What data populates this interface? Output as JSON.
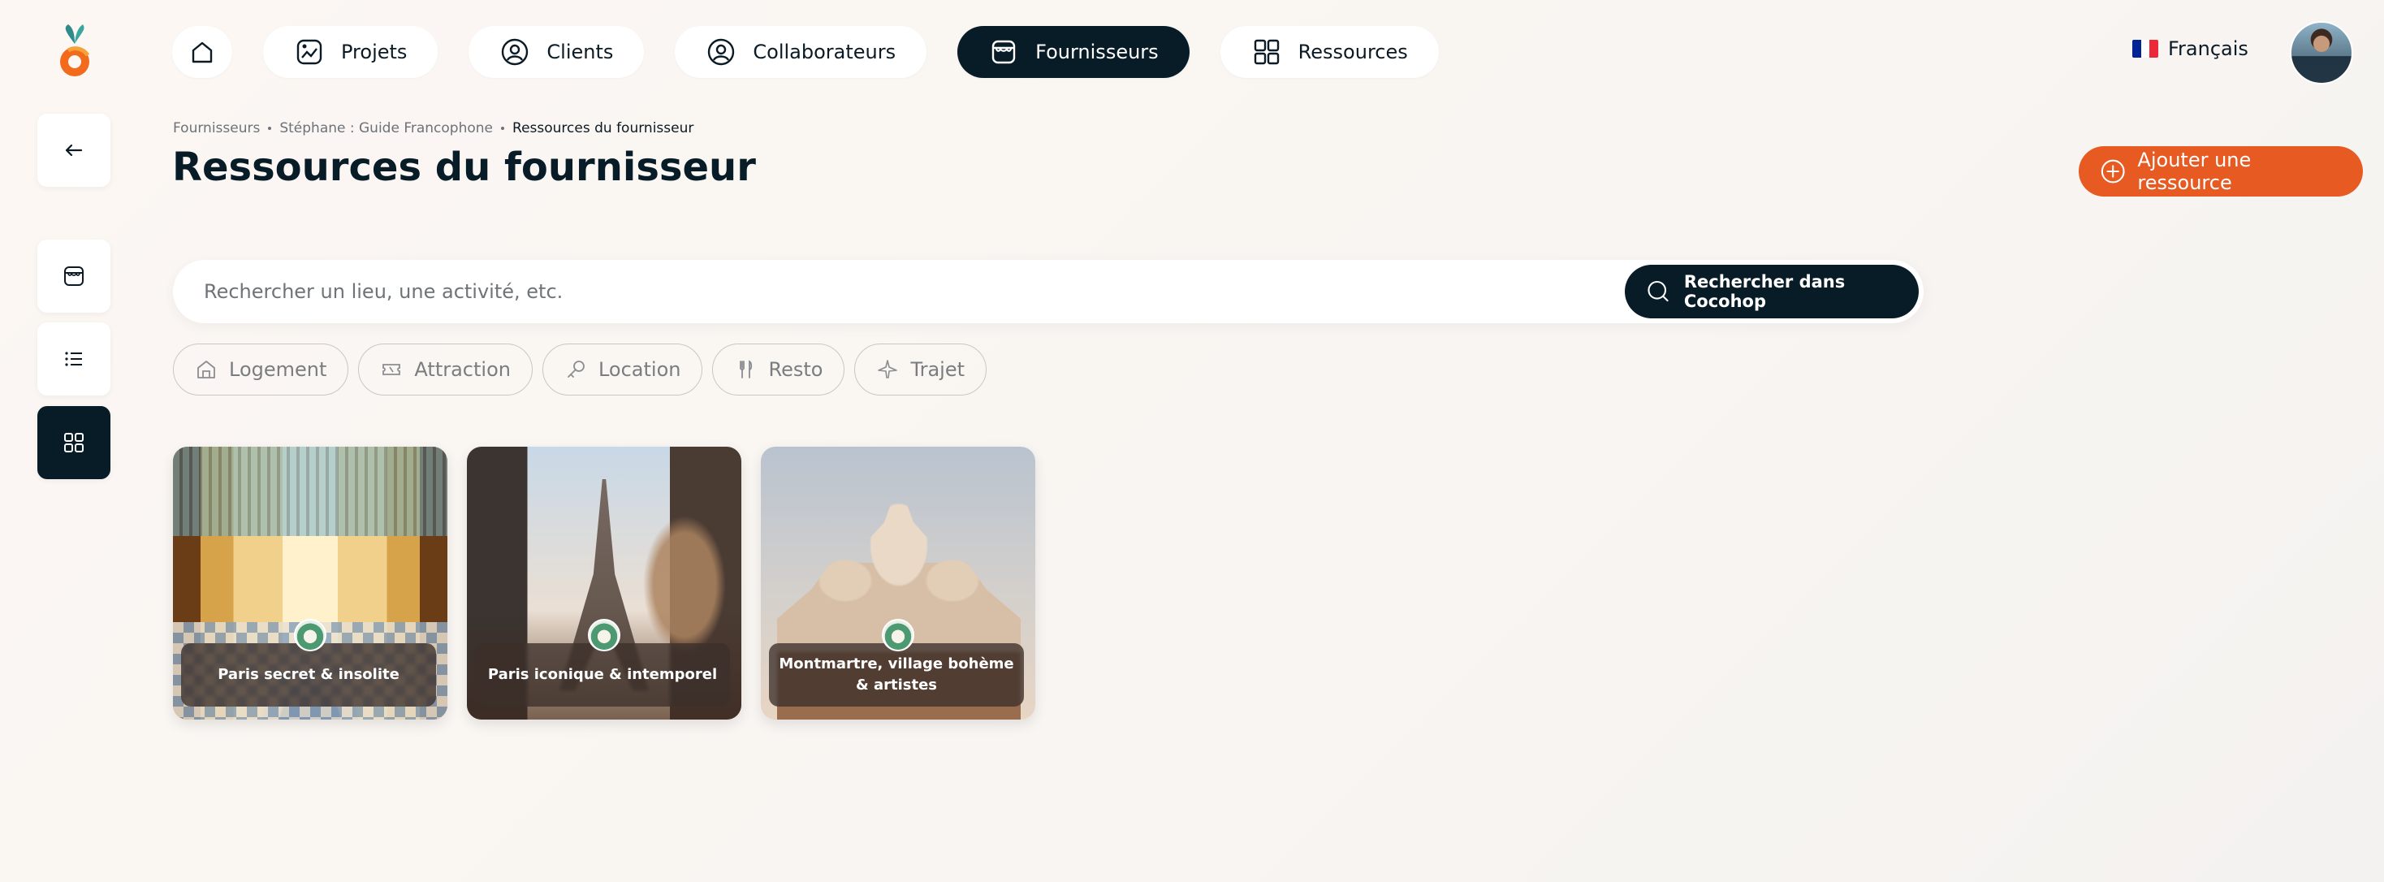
{
  "nav": {
    "items": [
      {
        "key": "home",
        "label": "",
        "icon": "home-icon"
      },
      {
        "key": "projets",
        "label": "Projets",
        "icon": "projects-icon"
      },
      {
        "key": "clients",
        "label": "Clients",
        "icon": "user-circle-icon"
      },
      {
        "key": "collaborateurs",
        "label": "Collaborateurs",
        "icon": "user-circle-icon"
      },
      {
        "key": "fournisseurs",
        "label": "Fournisseurs",
        "icon": "store-icon",
        "active": true
      },
      {
        "key": "ressources",
        "label": "Ressources",
        "icon": "grid-icon"
      }
    ]
  },
  "language": {
    "label": "Français",
    "flag_colors": [
      "#002395",
      "#ffffff",
      "#ed2939"
    ]
  },
  "breadcrumb": {
    "items": [
      "Fournisseurs",
      "Stéphane : Guide Francophone",
      "Ressources du fournisseur"
    ]
  },
  "page": {
    "title": "Ressources du fournisseur"
  },
  "actions": {
    "add_label": "Ajouter une ressource"
  },
  "search": {
    "placeholder": "Rechercher un lieu, une activité, etc.",
    "value": "",
    "button_label": "Rechercher dans Cocohop"
  },
  "filters": [
    {
      "label": "Logement",
      "icon": "lodging-icon"
    },
    {
      "label": "Attraction",
      "icon": "ticket-icon"
    },
    {
      "label": "Location",
      "icon": "key-icon"
    },
    {
      "label": "Resto",
      "icon": "cutlery-icon"
    },
    {
      "label": "Trajet",
      "icon": "plane-icon"
    }
  ],
  "cards": [
    {
      "title": "Paris secret & insolite"
    },
    {
      "title": "Paris iconique & intemporel"
    },
    {
      "title": "Montmartre, village bohème & artistes"
    }
  ],
  "colors": {
    "dark": "#081c28",
    "accent": "#e75a22",
    "background": "#fcf7f3"
  }
}
